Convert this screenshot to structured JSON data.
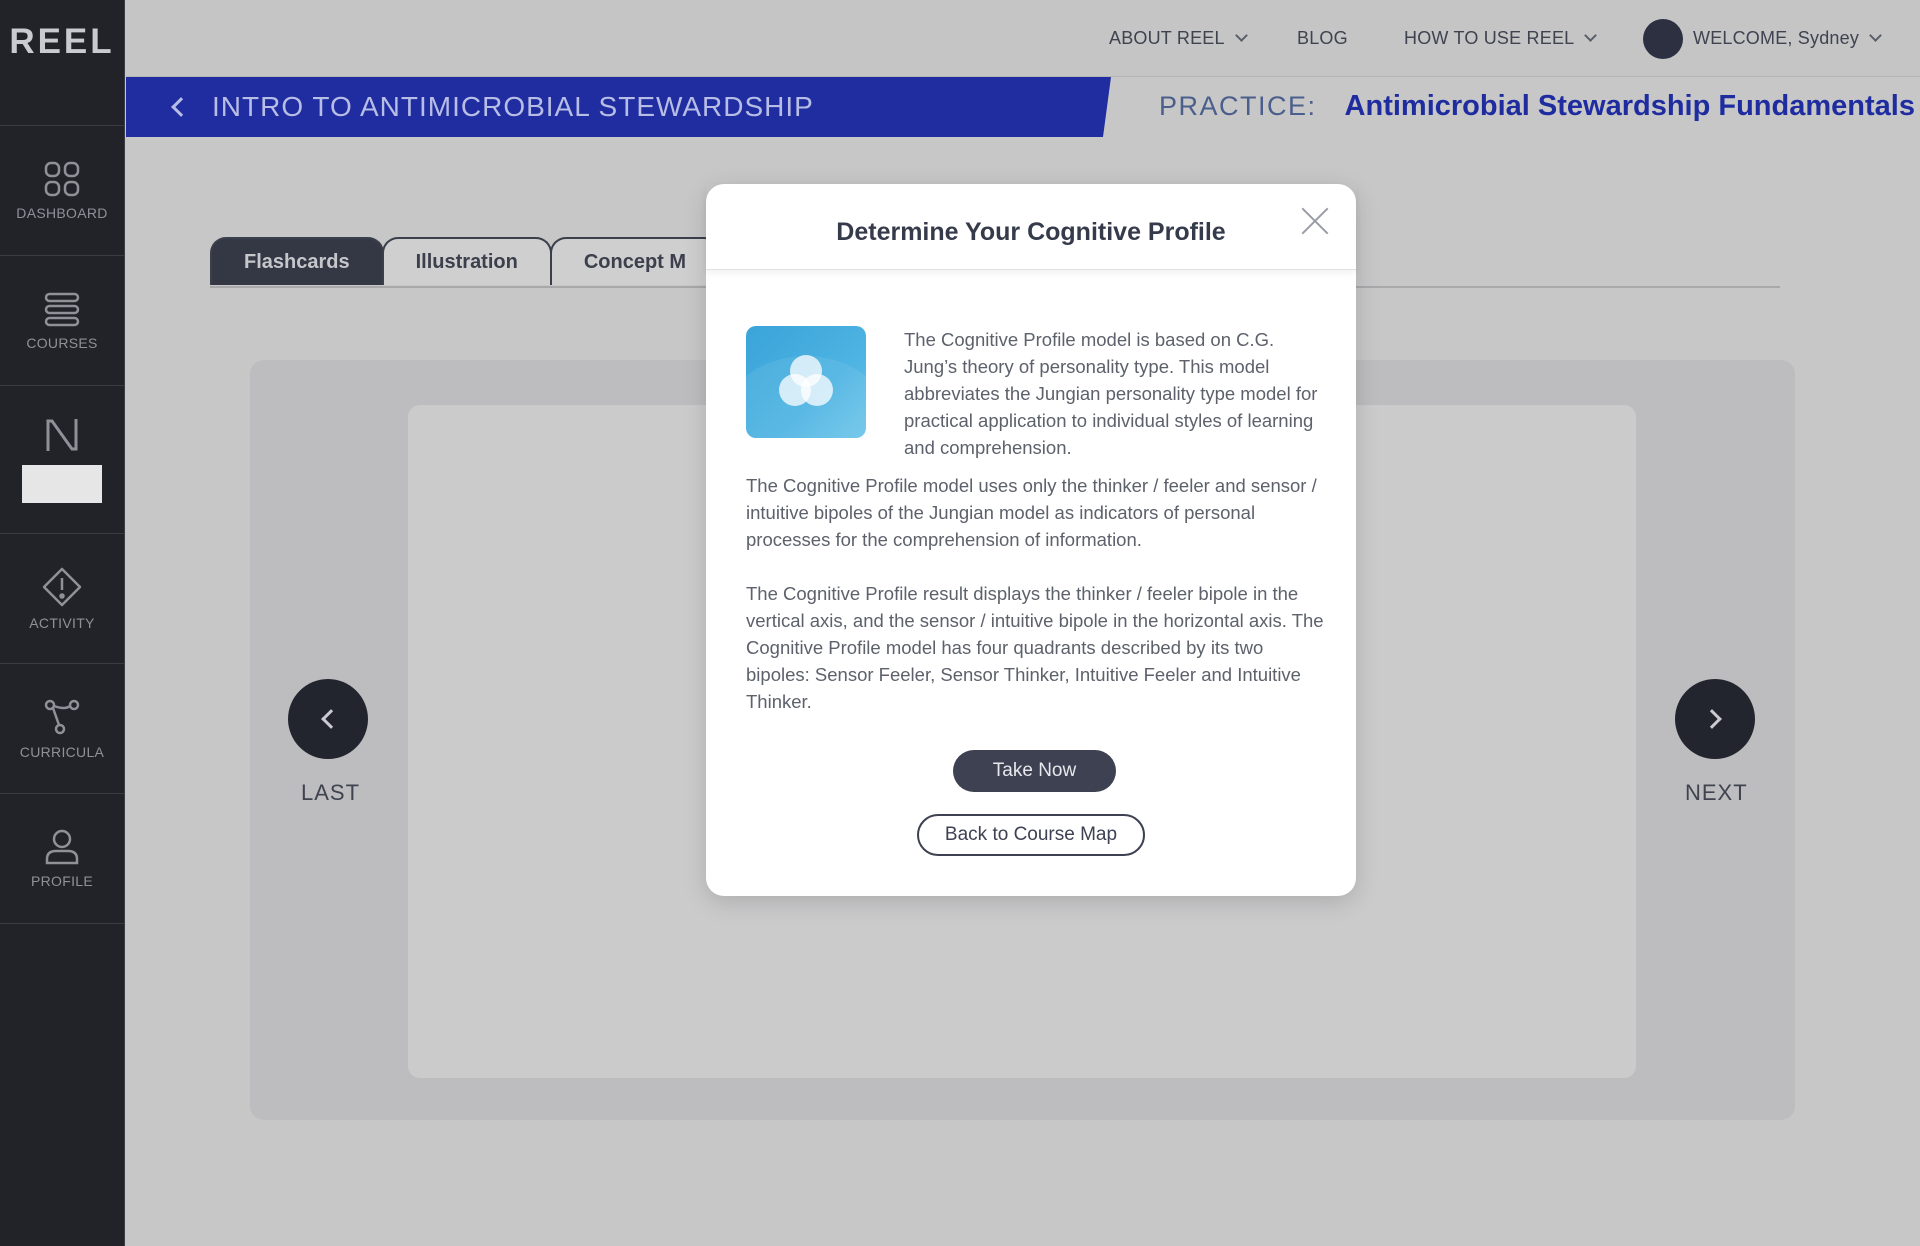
{
  "app": {
    "logo": "REEL"
  },
  "sidebar": {
    "items": [
      {
        "label": "DASHBOARD",
        "icon": "grid-icon"
      },
      {
        "label": "COURSES",
        "icon": "stack-icon"
      },
      {
        "label": "",
        "icon": "n-logo-icon"
      },
      {
        "label": "ACTIVITY",
        "icon": "alert-diamond-icon"
      },
      {
        "label": "CURRICULA",
        "icon": "branch-icon"
      },
      {
        "label": "PROFILE",
        "icon": "user-icon"
      }
    ]
  },
  "topnav": {
    "about": "ABOUT REEL",
    "blog": "BLOG",
    "how_to": "HOW TO USE REEL",
    "welcome": "WELCOME, Sydney"
  },
  "header": {
    "course_title": "INTRO TO ANTIMICROBIAL STEWARDSHIP",
    "practice_label": "PRACTICE:",
    "practice_name": "Antimicrobial Stewardship Fundamentals"
  },
  "tabs": [
    {
      "label": "Flashcards",
      "active": true
    },
    {
      "label": "Illustration",
      "active": false
    },
    {
      "label": "Concept M",
      "active": false
    }
  ],
  "card_nav": {
    "last": "LAST",
    "next": "NEXT"
  },
  "modal": {
    "title": "Determine Your Cognitive Profile",
    "intro": "The Cognitive Profile model is based on C.G. Jung’s theory of personality type. This model abbreviates the Jungian personality type model for practical application to individual styles of learning and comprehension.",
    "para1": "The Cognitive Profile model uses only the thinker / feeler and sensor / intuitive bipoles of the Jungian model as indicators of personal processes for the comprehension of information.",
    "para2": "The Cognitive Profile result displays the thinker / feeler bipole in the vertical axis, and the sensor / intuitive bipole in the horizontal axis. The Cognitive Profile model has four quadrants described by its two bipoles: Sensor Feeler, Sensor Thinker, Intuitive Feeler and Intuitive Thinker.",
    "take_now": "Take Now",
    "back_to_map": "Back to Course Map"
  },
  "colors": {
    "title_band": "#1f2da0",
    "sidebar": "#212329",
    "primary_button": "#3d4152",
    "profile_icon": "#3aa3d8"
  }
}
